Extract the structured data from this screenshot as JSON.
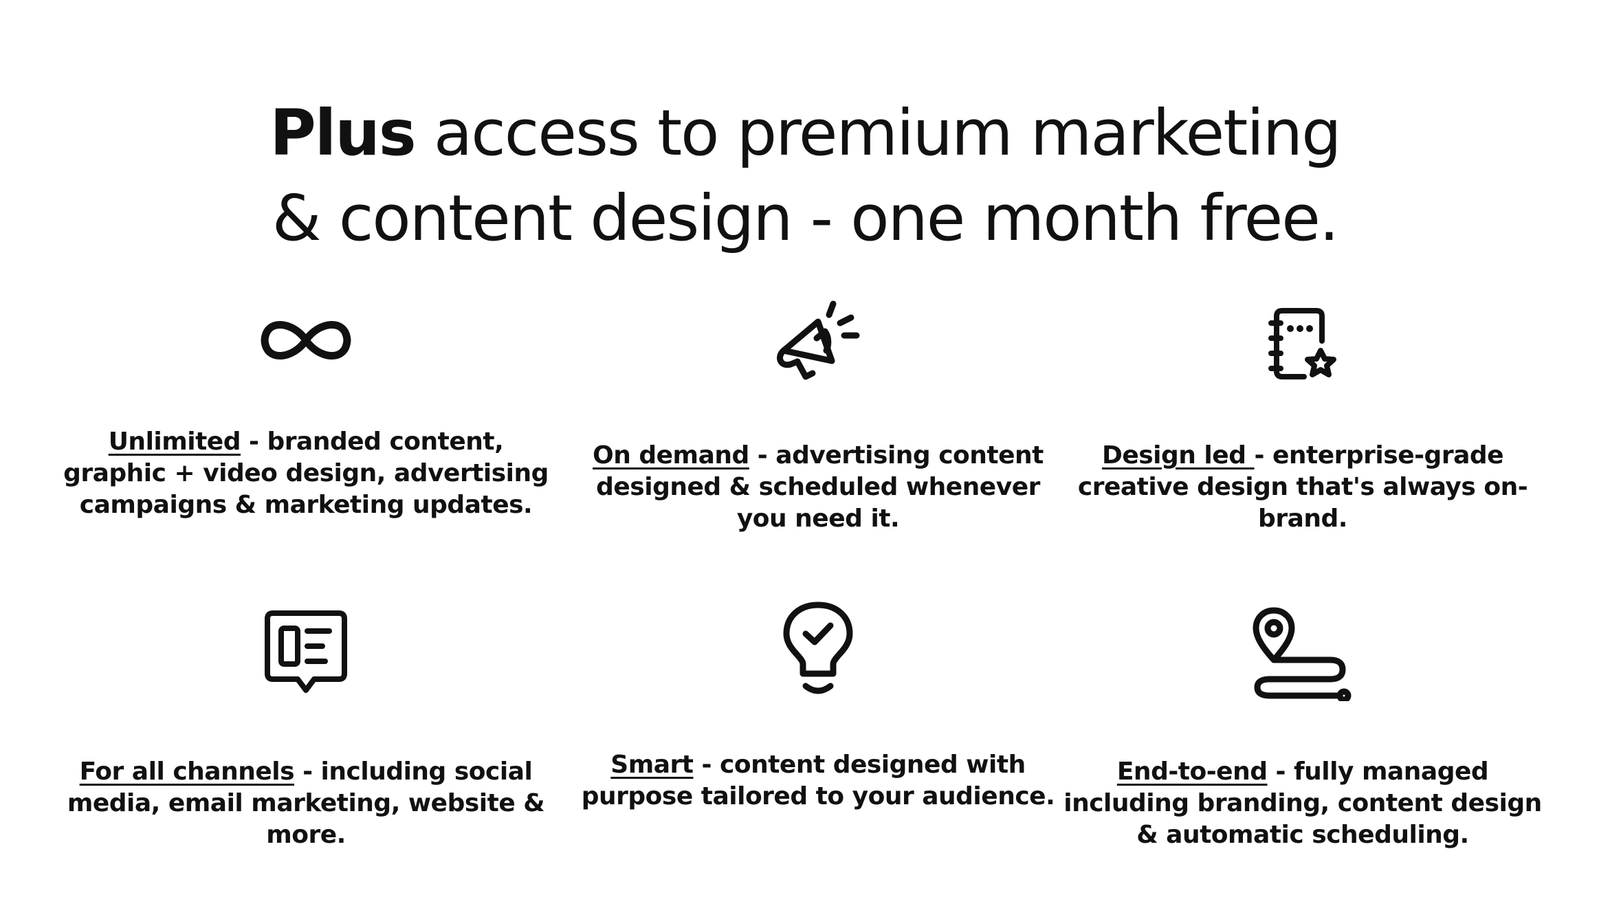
{
  "headline": {
    "strong": "Plus",
    "line1_rest": " access to premium marketing",
    "line2": "& content design - one month free."
  },
  "features": [
    {
      "icon": "infinity-icon",
      "term": "Unlimited",
      "text": " - branded content, graphic + video design, advertising campaigns & marketing updates."
    },
    {
      "icon": "megaphone-icon",
      "term": "On demand",
      "text": " -  advertising content designed & scheduled whenever you need it."
    },
    {
      "icon": "notebook-star-icon",
      "term": "Design led ",
      "text": "- enterprise-grade creative design that's always on-brand."
    },
    {
      "icon": "chat-document-icon",
      "term": "For all channels",
      "text": " - including social media, email marketing, website & more."
    },
    {
      "icon": "lightbulb-check-icon",
      "term": "Smart",
      "text": " - content designed with purpose tailored to your audience."
    },
    {
      "icon": "route-pin-icon",
      "term": "End-to-end",
      "text": " - fully managed including branding, content design & automatic scheduling."
    }
  ],
  "colors": {
    "text": "#111111",
    "background": "#ffffff"
  }
}
